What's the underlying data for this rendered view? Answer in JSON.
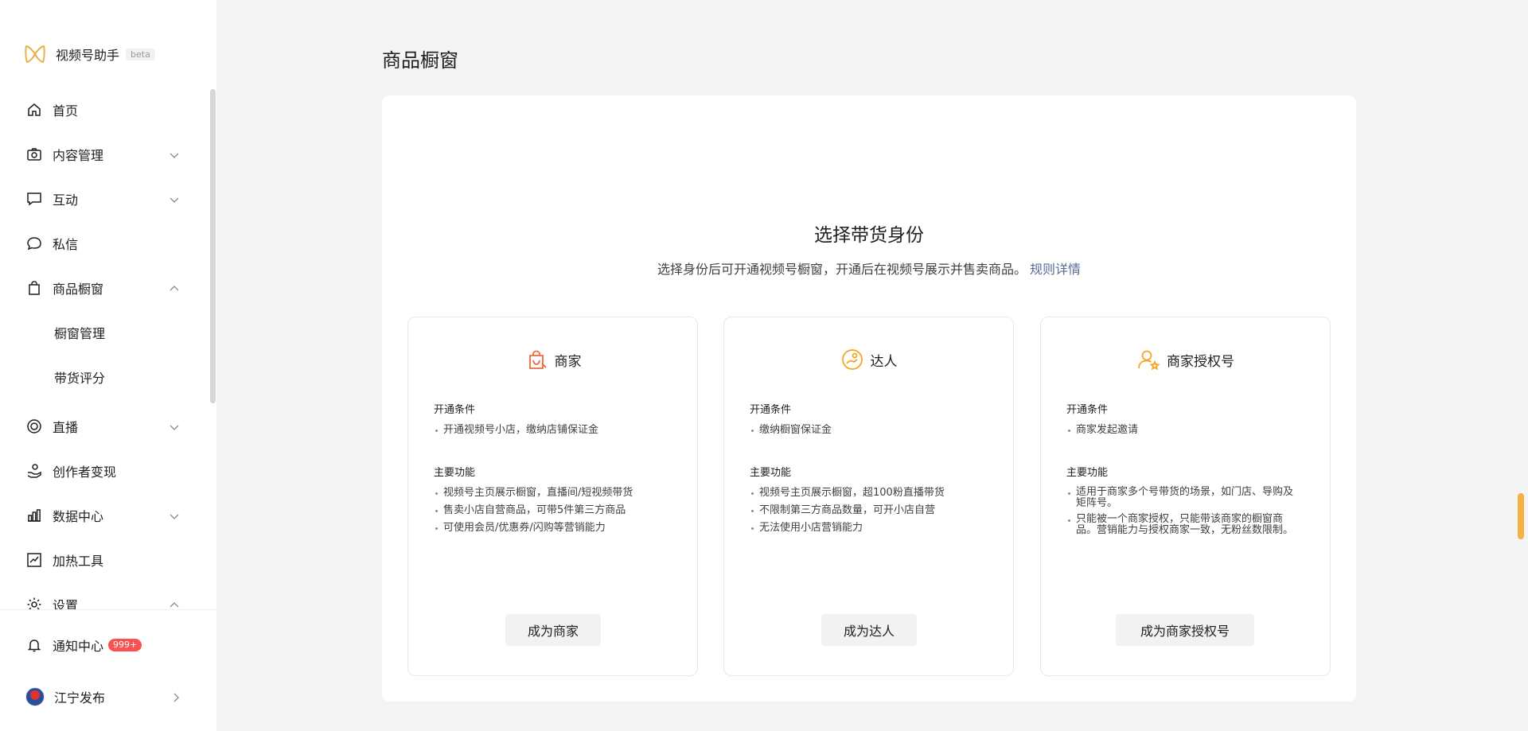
{
  "brand": {
    "name": "视频号助手",
    "beta": "beta"
  },
  "sidebar": {
    "items": [
      {
        "label": "首页",
        "icon": "home-icon"
      },
      {
        "label": "内容管理",
        "icon": "camera-icon",
        "expanded": false
      },
      {
        "label": "互动",
        "icon": "comment-icon",
        "expanded": false
      },
      {
        "label": "私信",
        "icon": "chat-bubble-icon"
      },
      {
        "label": "商品橱窗",
        "icon": "shopping-bag-icon",
        "expanded": true
      },
      {
        "label": "橱窗管理"
      },
      {
        "label": "带货评分"
      },
      {
        "label": "直播",
        "icon": "live-icon",
        "expanded": false
      },
      {
        "label": "创作者变现",
        "icon": "hand-coin-icon"
      },
      {
        "label": "数据中心",
        "icon": "bar-chart-icon",
        "expanded": false
      },
      {
        "label": "加热工具",
        "icon": "trend-icon"
      },
      {
        "label": "设置",
        "icon": "gear-icon",
        "expanded": true
      }
    ],
    "notification": {
      "label": "通知中心",
      "badge": "999+"
    },
    "account": {
      "name": "江宁发布"
    }
  },
  "page": {
    "title": "商品橱窗"
  },
  "selection": {
    "heading": "选择带货身份",
    "description": "选择身份后可开通视频号橱窗，开通后在视频号展示并售卖商品。",
    "rule_link": "规则详情"
  },
  "cards": [
    {
      "title": "商家",
      "icon": "shop-bag-icon",
      "cond_label": "开通条件",
      "conditions": [
        "开通视频号小店，缴纳店铺保证金"
      ],
      "feat_label": "主要功能",
      "features": [
        "视频号主页展示橱窗，直播间/短视频带货",
        "售卖小店自营商品，可带5件第三方商品",
        "可使用会员/优惠券/闪购等营销能力"
      ],
      "button": "成为商家"
    },
    {
      "title": "达人",
      "icon": "influencer-icon",
      "cond_label": "开通条件",
      "conditions": [
        "缴纳橱窗保证金"
      ],
      "feat_label": "主要功能",
      "features": [
        "视频号主页展示橱窗，超100粉直播带货",
        "不限制第三方商品数量，可开小店自营",
        "无法使用小店营销能力"
      ],
      "button": "成为达人"
    },
    {
      "title": "商家授权号",
      "icon": "authorized-user-icon",
      "cond_label": "开通条件",
      "conditions": [
        "商家发起邀请"
      ],
      "feat_label": "主要功能",
      "features": [
        "适用于商家多个号带货的场景，如门店、导购及矩阵号。",
        "只能被一个商家授权，只能带该商家的橱窗商品。营销能力与授权商家一致，无粉丝数限制。"
      ],
      "button": "成为商家授权号"
    }
  ],
  "colors": {
    "accent": "#f5a623",
    "link": "#576b95",
    "badge": "#fa5151"
  }
}
